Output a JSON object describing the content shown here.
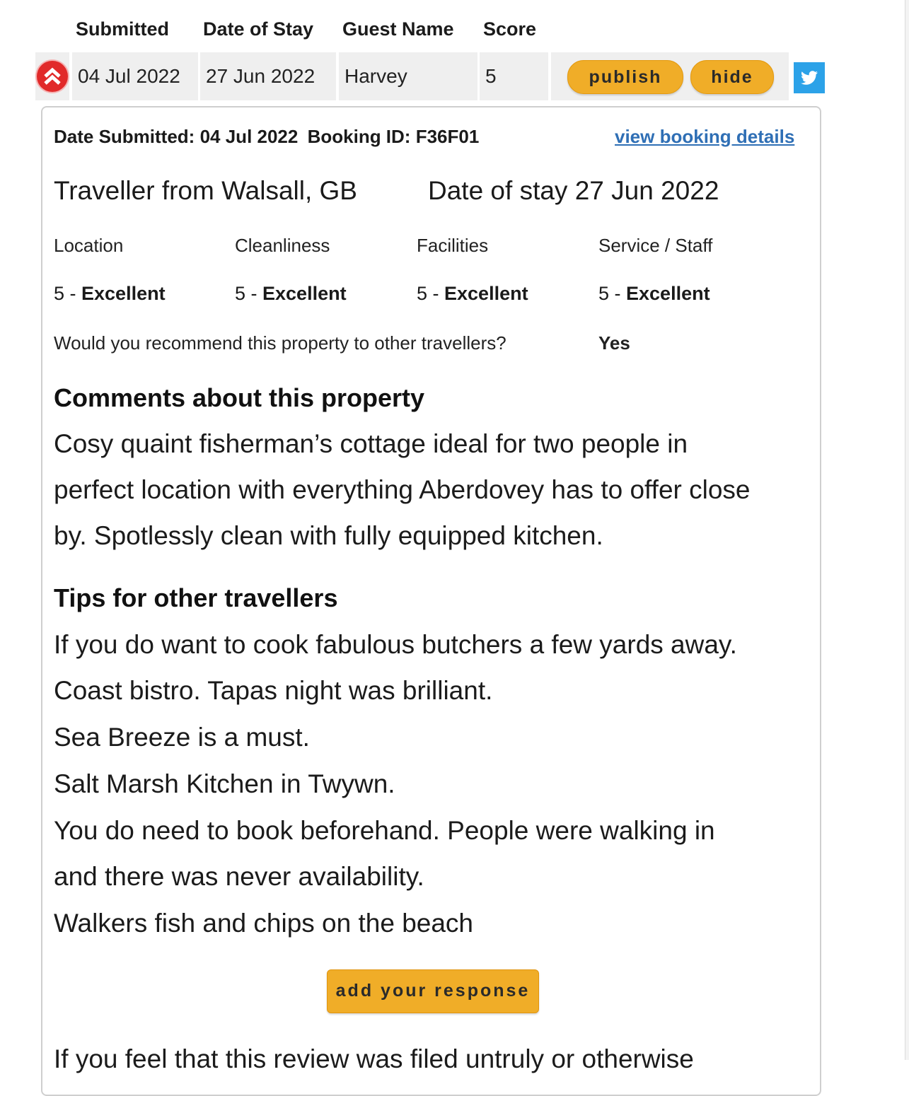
{
  "table": {
    "headers": [
      "Submitted",
      "Date of Stay",
      "Guest Name",
      "Score"
    ],
    "row": {
      "submitted": "04 Jul 2022",
      "date_of_stay": "27 Jun 2022",
      "guest_name": "Harvey",
      "score": "5"
    },
    "publish_label": "publish",
    "hide_label": "hide"
  },
  "review": {
    "date_submitted_label": "Date Submitted:",
    "date_submitted": "04 Jul 2022",
    "booking_id_label": "Booking ID:",
    "booking_id": "F36F01",
    "view_booking_link": "view booking details",
    "traveller_from": "Traveller from Walsall, GB",
    "date_of_stay_text": "Date of stay 27 Jun 2022",
    "ratings": [
      {
        "category": "Location",
        "score": "5 - ",
        "word": "Excellent"
      },
      {
        "category": "Cleanliness",
        "score": "5 - ",
        "word": "Excellent"
      },
      {
        "category": "Facilities",
        "score": "5 - ",
        "word": "Excellent"
      },
      {
        "category": "Service / Staff",
        "score": "5 - ",
        "word": "Excellent"
      }
    ],
    "recommend_question": "Would you recommend this property to other travellers?",
    "recommend_answer": "Yes",
    "comments_heading": "Comments about this property",
    "comments_lines": [
      "Cosy quaint fisherman’s cottage ideal for two people in",
      "perfect location with everything Aberdovey has to offer close",
      "by. Spotlessly clean with fully equipped kitchen."
    ],
    "tips_heading": "Tips for other travellers",
    "tips_lines": [
      "If you do want to cook fabulous butchers a few yards away.",
      "Coast bistro. Tapas night was brilliant.",
      "Sea Breeze is a must.",
      "Salt Marsh Kitchen in Twywn.",
      "You do need to book beforehand. People were walking in",
      "and there was never availability.",
      "Walkers fish and chips on the beach"
    ],
    "add_response_label": "add your response",
    "cut_off_line": "If you feel that this review was filed untruly or otherwise"
  },
  "colors": {
    "button": "#f0ad28",
    "link": "#2f6fb5",
    "alert_icon": "#e12a2a",
    "twitter": "#2ca2e8"
  },
  "icons": [
    "alert-chevron-up-icon",
    "twitter-icon"
  ]
}
